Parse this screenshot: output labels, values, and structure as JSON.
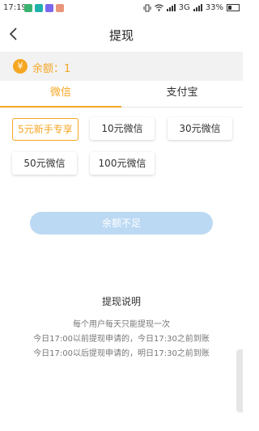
{
  "statusbar": {
    "time": "17:19",
    "network": "3G",
    "battery": "33%"
  },
  "header": {
    "title": "提现",
    "back_icon": "chevron-left-icon"
  },
  "balance": {
    "icon_symbol": "¥",
    "text": "余额：1",
    "color": "#f5a623"
  },
  "tabs": [
    {
      "label": "微信",
      "active": true
    },
    {
      "label": "支付宝",
      "active": false
    }
  ],
  "amounts": [
    {
      "label": "5元新手专享",
      "selected": true
    },
    {
      "label": "10元微信",
      "selected": false
    },
    {
      "label": "30元微信",
      "selected": false
    },
    {
      "label": "50元微信",
      "selected": false
    },
    {
      "label": "100元微信",
      "selected": false
    }
  ],
  "submit": {
    "label": "余额不足",
    "bg_color": "#bcd9f3"
  },
  "notes": {
    "title": "提现说明",
    "lines": [
      "每个用户每天只能提现一次",
      "今日17:00以前提现申请的，今日17:30之前到账",
      "今日17:00以后提现申请的，明日17:30之前到账"
    ]
  }
}
